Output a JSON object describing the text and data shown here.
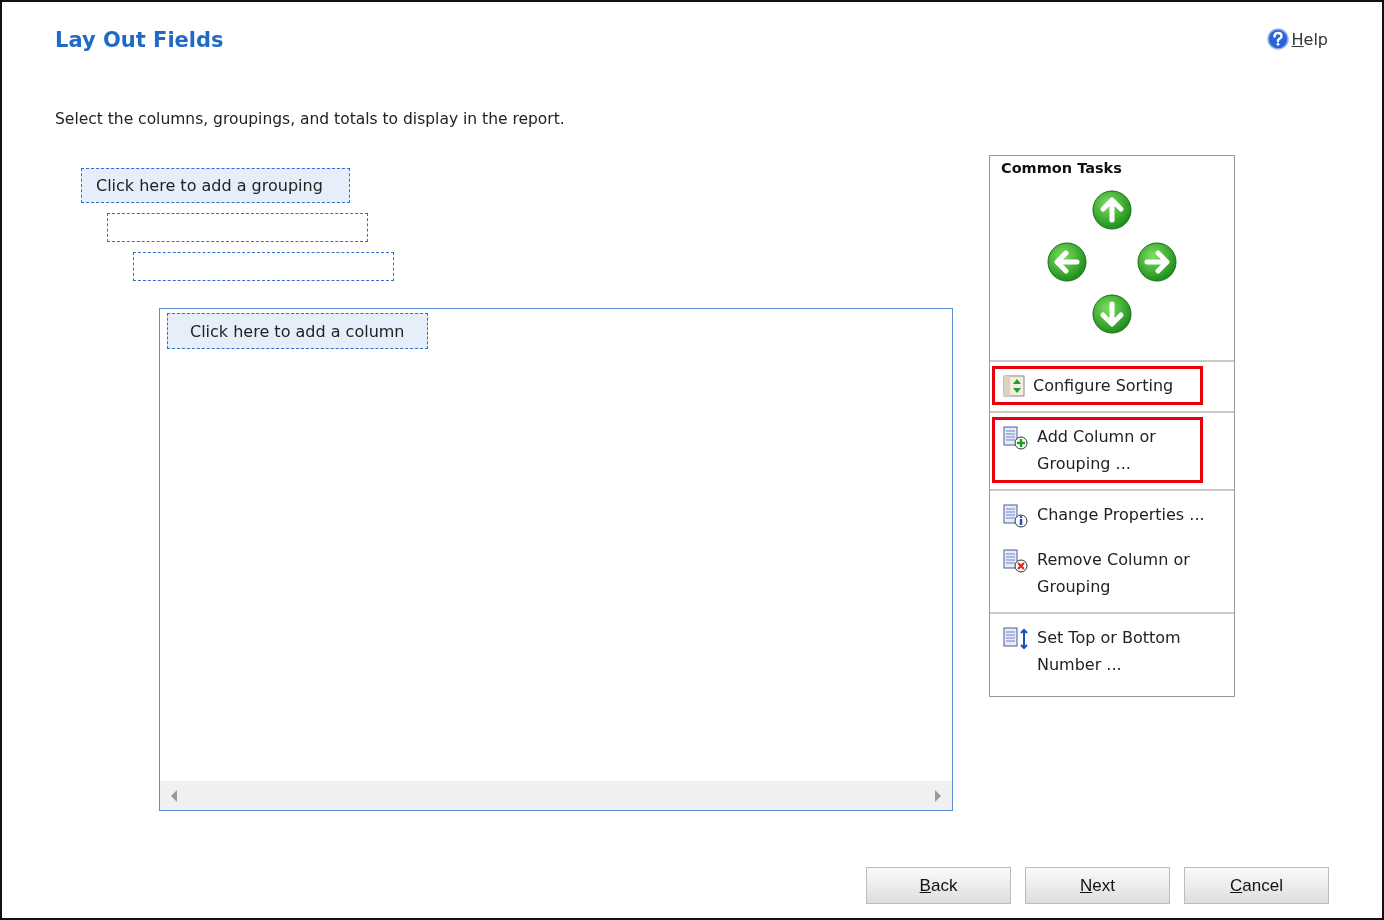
{
  "title": "Lay Out Fields",
  "help": {
    "label": "Help"
  },
  "description": "Select the columns, groupings, and totals to display in the report.",
  "grouping": {
    "kind": "placeholder",
    "label": "Click here to add a grouping",
    "children": [
      {
        "kind": "empty",
        "children": [
          {
            "kind": "empty"
          }
        ]
      }
    ]
  },
  "column_area": {
    "placeholder": "Click here to add a column"
  },
  "common_tasks": {
    "title": "Common Tasks",
    "sections": [
      {
        "items": [
          {
            "kind": "sort",
            "label": "Configure Sorting",
            "highlighted": true
          }
        ]
      },
      {
        "items": [
          {
            "kind": "add",
            "label": "Add Column or Grouping ...",
            "highlighted": true
          }
        ]
      },
      {
        "items": [
          {
            "kind": "properties",
            "label": "Change Properties ...",
            "highlighted": false
          },
          {
            "kind": "remove",
            "label": "Remove Column or Grouping",
            "highlighted": false
          }
        ]
      },
      {
        "items": [
          {
            "kind": "topbottom",
            "label": "Set Top or Bottom Number ...",
            "highlighted": false
          }
        ]
      }
    ]
  },
  "buttons": [
    {
      "label": "Back"
    },
    {
      "label": "Next"
    },
    {
      "label": "Cancel"
    }
  ]
}
